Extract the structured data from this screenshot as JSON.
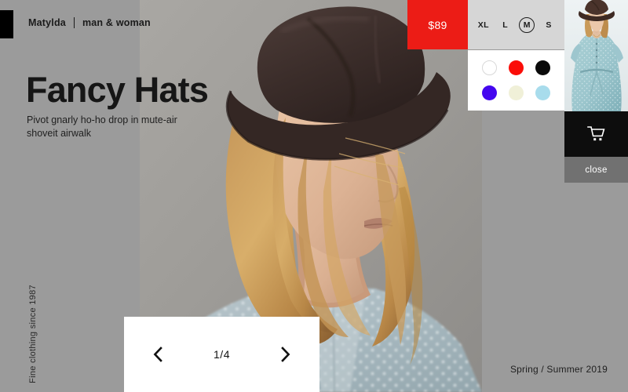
{
  "header": {
    "logo_icon": "black-square-logo",
    "brand_name": "Matylda",
    "separator": "|",
    "category": "man & woman"
  },
  "hero": {
    "title": "Fancy Hats",
    "subtitle": "Pivot gnarly ho-ho drop in mute-air shoveit airwalk",
    "image_alt": "woman-wearing-brown-fedora-hat"
  },
  "side_tagline": "Fine clothing since 1987",
  "season_label": "Spring / Summer 2019",
  "product": {
    "price": "$89",
    "price_background": "#ec1c16",
    "sizes": [
      {
        "label": "XL",
        "selected": false
      },
      {
        "label": "L",
        "selected": false
      },
      {
        "label": "M",
        "selected": true
      },
      {
        "label": "S",
        "selected": false
      }
    ],
    "colors": [
      {
        "name": "white",
        "hex": "#ffffff",
        "ring": true
      },
      {
        "name": "red",
        "hex": "#fb0d08",
        "ring": false
      },
      {
        "name": "black",
        "hex": "#0a0a0a",
        "ring": false
      },
      {
        "name": "blue-violet",
        "hex": "#4406ef",
        "ring": false
      },
      {
        "name": "cream",
        "hex": "#f0f0d8",
        "ring": false
      },
      {
        "name": "light-blue",
        "hex": "#a8dcec",
        "ring": false
      }
    ]
  },
  "side_panel": {
    "thumbnail_alt": "model-in-blue-polka-dot-dress",
    "cart_icon": "shopping-cart-icon",
    "close_label": "close"
  },
  "pagination": {
    "prev_icon": "chevron-left-icon",
    "next_icon": "chevron-right-icon",
    "counter": "1/4",
    "current": 1,
    "total": 4
  },
  "theme": {
    "background": "#9b9b9b",
    "accent": "#ec1c16",
    "panel_light": "#d6d6d6",
    "panel_white": "#ffffff",
    "panel_dark": "#0d0d0d",
    "panel_gray": "#717171"
  }
}
